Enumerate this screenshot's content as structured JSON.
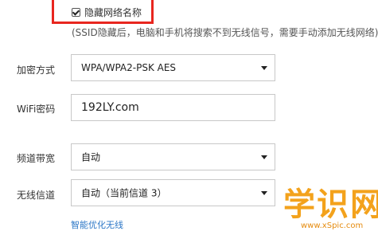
{
  "hidden_ssid": {
    "label": "隐藏网络名称",
    "checked": true,
    "note": "(SSID隐藏后，电脑和手机将搜索不到无线信号，需要手动添加无线网络)"
  },
  "encryption": {
    "label": "加密方式",
    "value": "WPA/WPA2-PSK AES"
  },
  "wifi_password": {
    "label": "WiFi密码",
    "value": "192LY.com"
  },
  "bandwidth": {
    "label": "频道带宽",
    "value": "自动"
  },
  "channel": {
    "label": "无线信道",
    "value": "自动（当前信道 3）"
  },
  "smart_optimize_link": "智能优化无线",
  "watermark": {
    "text": "学识网",
    "url": "www.xSpic.com"
  },
  "colors": {
    "highlight": "#e8261f",
    "link": "#2e78c7",
    "watermark": "#f3a21c"
  }
}
